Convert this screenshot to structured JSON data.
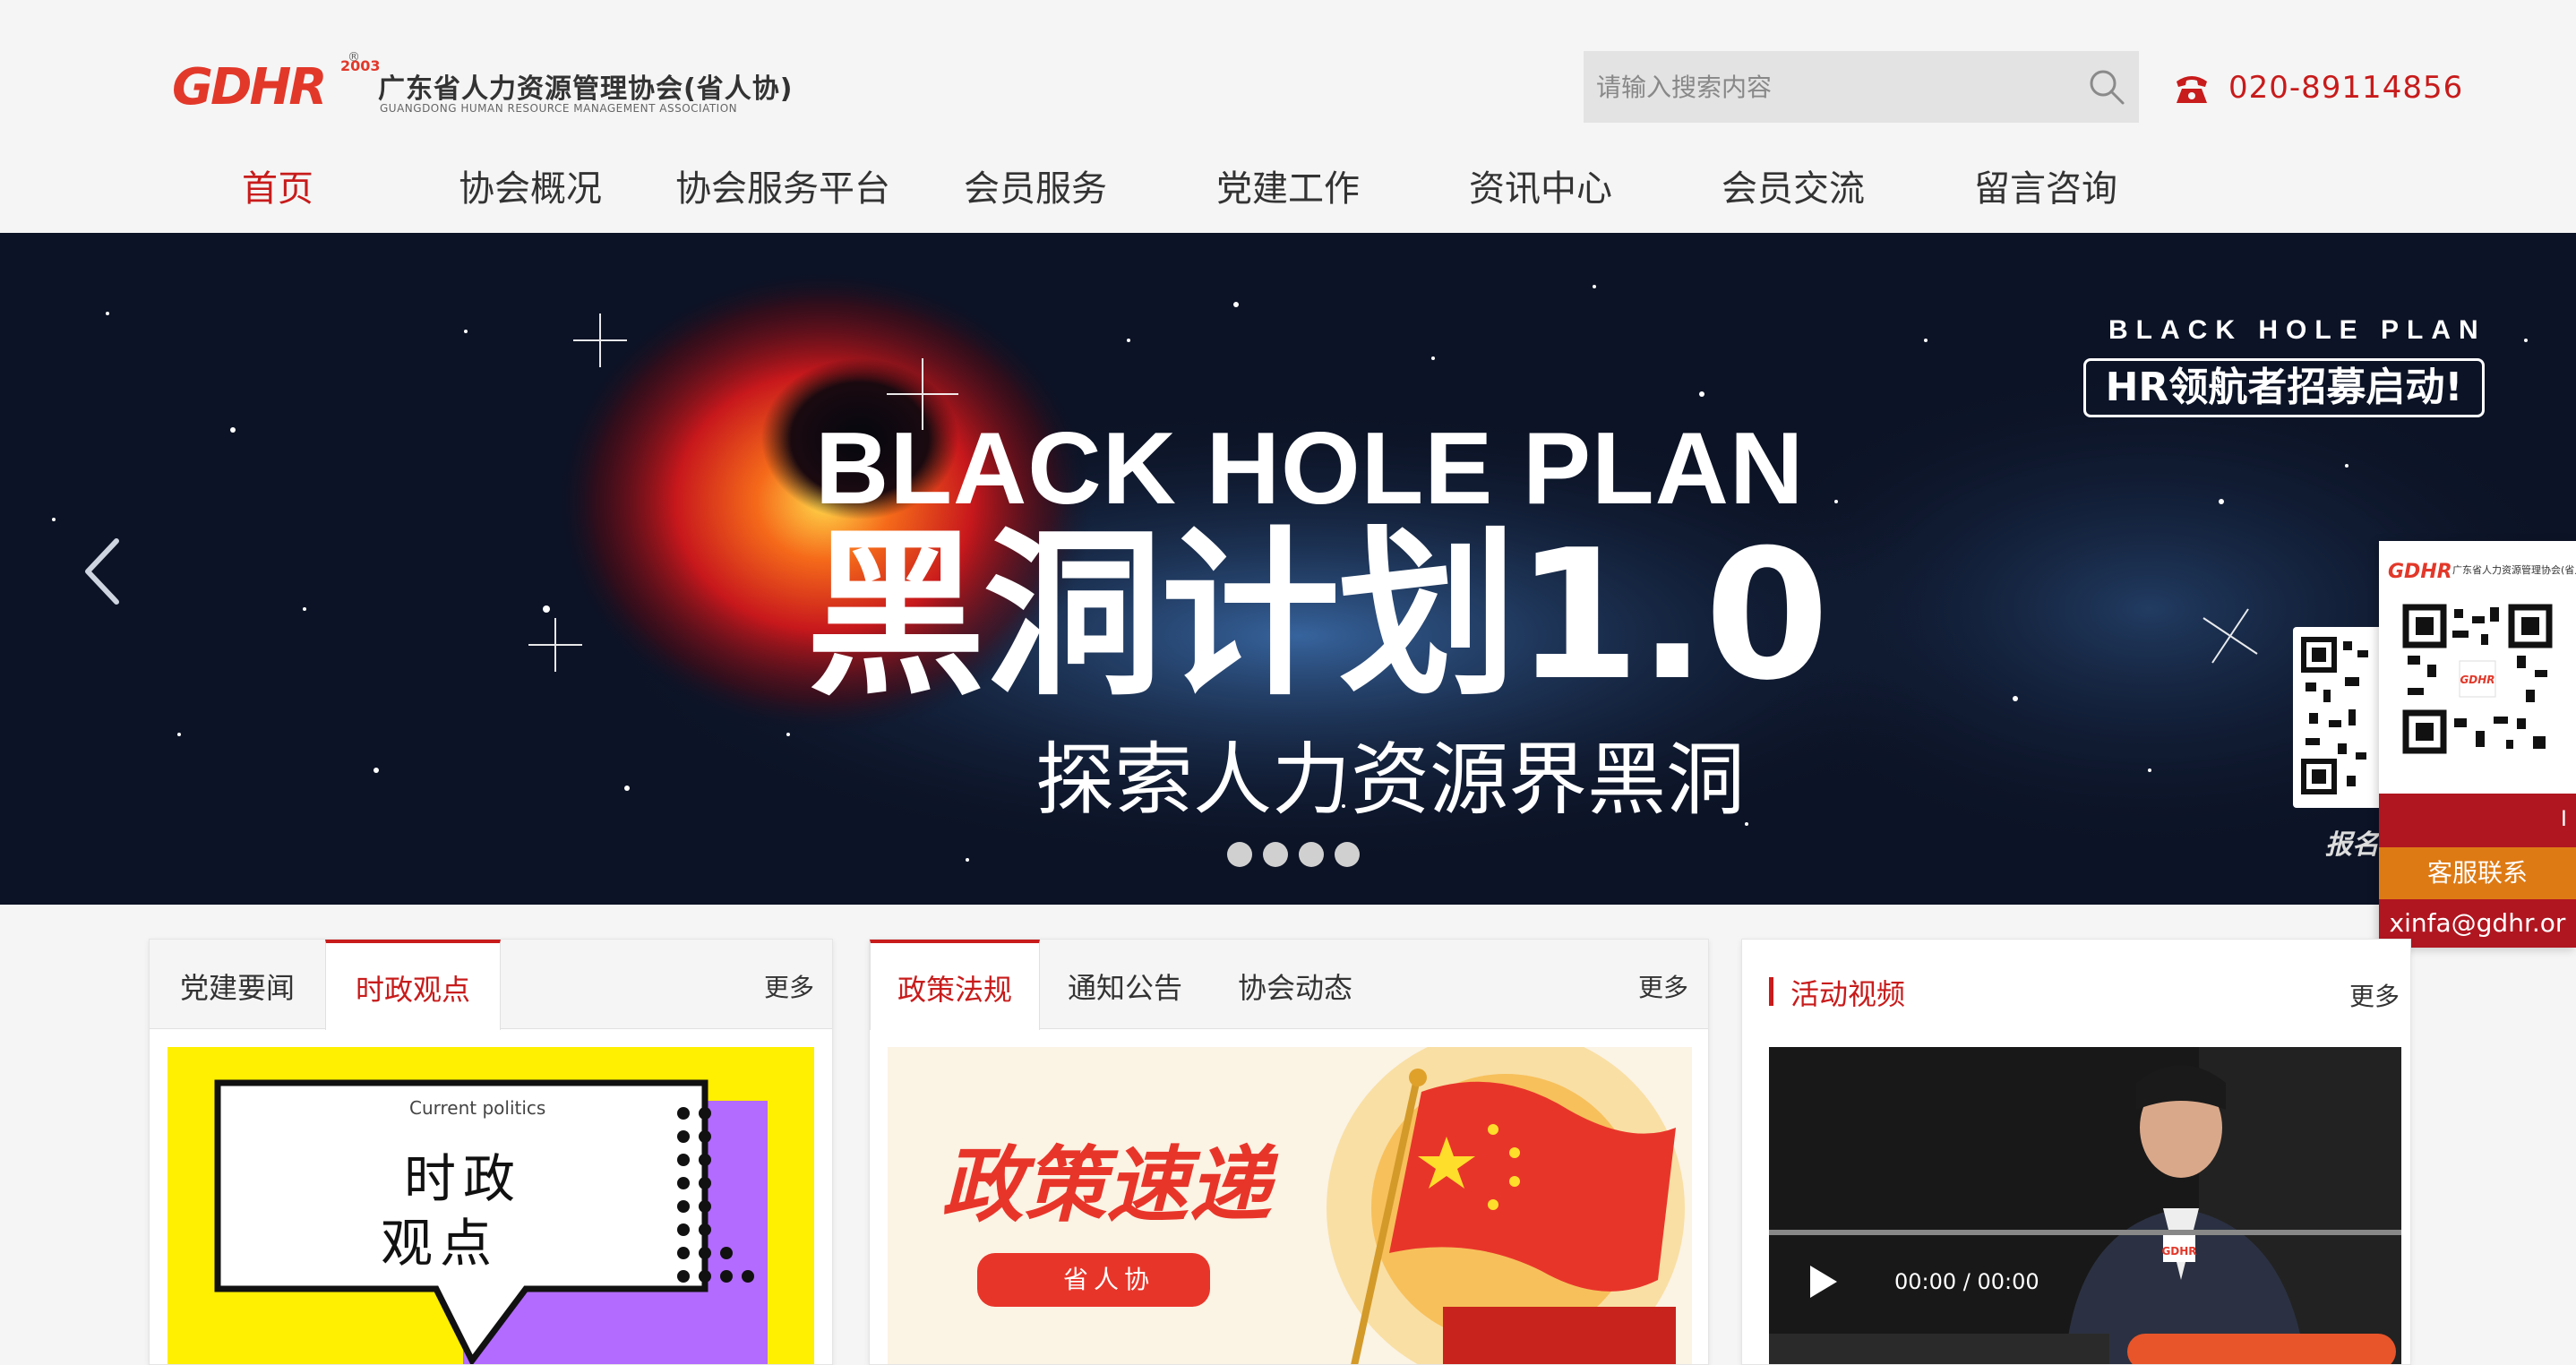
{
  "header": {
    "logo_mark": "GDHR",
    "logo_year": "2003",
    "logo_reg": "®",
    "logo_cn": "广东省人力资源管理协会(省人协)",
    "logo_en": "GUANGDONG HUMAN RESOURCE MANAGEMENT ASSOCIATION",
    "search_placeholder": "请输入搜索内容",
    "phone": "020-89114856"
  },
  "nav": {
    "items": [
      {
        "label": "首页",
        "active": true
      },
      {
        "label": "协会概况"
      },
      {
        "label": "协会服务平台"
      },
      {
        "label": "会员服务"
      },
      {
        "label": "党建工作"
      },
      {
        "label": "资讯中心"
      },
      {
        "label": "会员交流"
      },
      {
        "label": "留言咨询"
      }
    ]
  },
  "banner": {
    "title_en": "BLACK HOLE PLAN",
    "title_cn": "黑洞计划1.0",
    "subtitle": "探索人力资源界黑洞",
    "badge_en": "BLACK HOLE PLAN",
    "badge_cn": "HR领航者招募启动!",
    "qr_label": "报名",
    "slide_count": 4
  },
  "side_panel": {
    "logo": "GDHR",
    "logo_cn": "广东省人力资源管理协会(省人协)",
    "red_text": "I",
    "contact": "客服联系",
    "email": "xinfa@gdhr.or"
  },
  "cards": {
    "news": {
      "tabs": [
        "党建要闻",
        "时政观点"
      ],
      "active_tab": 1,
      "more": "更多",
      "image_caption_en": "Current politics",
      "image_caption_cn_1": "时政",
      "image_caption_cn_2": "观点"
    },
    "policy": {
      "tabs": [
        "政策法规",
        "通知公告",
        "协会动态"
      ],
      "active_tab": 0,
      "more": "更多",
      "image_title": "政策速递",
      "image_sub": "省人协"
    },
    "video": {
      "title": "活动视频",
      "more": "更多",
      "time_current": "00:00",
      "time_total": "00:00",
      "progress": 0
    }
  },
  "colors": {
    "brand_red": "#c81b1b",
    "orange": "#de7a14",
    "dark_red": "#b01620"
  }
}
